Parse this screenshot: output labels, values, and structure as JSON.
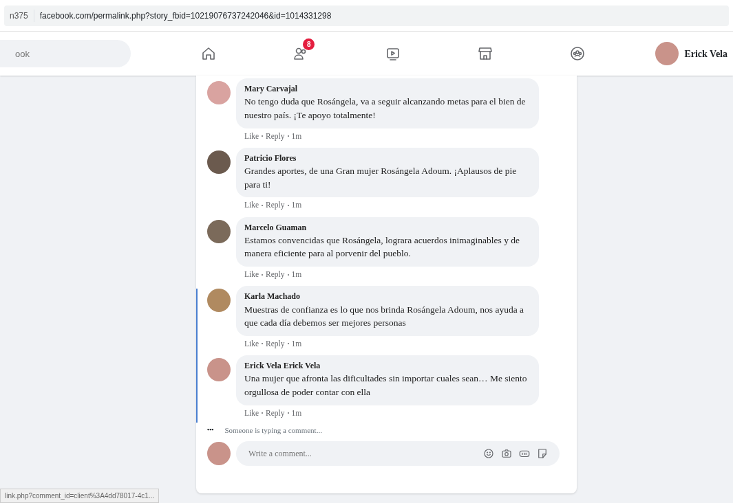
{
  "address_bar": {
    "tab_fragment": "n375",
    "url": "facebook.com/permalink.php?story_fbid=10219076737242046&id=1014331298"
  },
  "nav": {
    "search": {
      "placeholder": "ook"
    },
    "friends_badge": "8",
    "profile_name": "Erick Vela"
  },
  "comments": [
    {
      "author": "Mary Carvajal",
      "text": "No tengo duda que Rosángela, va a seguir alcanzando metas para el bien de nuestro país. ¡Te apoyo totalmente!",
      "actions": [
        "Like",
        "Reply"
      ],
      "time": "1m"
    },
    {
      "author": "Patricio Flores",
      "text": "Grandes aportes, de una Gran mujer Rosángela Adoum. ¡Aplausos de pie para ti!",
      "actions": [
        "Like",
        "Reply"
      ],
      "time": "1m"
    },
    {
      "author": "Marcelo Guaman",
      "text": "Estamos convencidas que Rosángela, lograra acuerdos inimaginables y de manera eficiente para al porvenir del pueblo.",
      "actions": [
        "Like",
        "Reply"
      ],
      "time": "1m"
    },
    {
      "author": "Karla Machado",
      "text": "Muestras de confianza es lo que nos brinda Rosángela Adoum, nos ayuda a que cada día debemos ser mejores personas",
      "actions": [
        "Like",
        "Reply"
      ],
      "time": "1m"
    },
    {
      "author": "Erick Vela Erick Vela",
      "text": "Una mujer que afronta las dificultades sin importar cuales sean… Me siento orgullosa de poder contar con ella",
      "actions": [
        "Like",
        "Reply"
      ],
      "time": "1m"
    }
  ],
  "typing": {
    "dots": "•••",
    "text": "Someone is typing a comment..."
  },
  "composer": {
    "placeholder": "Write a comment..."
  },
  "status_bar": "link.php?comment_id=client%3A4dd78017-4c1..."
}
